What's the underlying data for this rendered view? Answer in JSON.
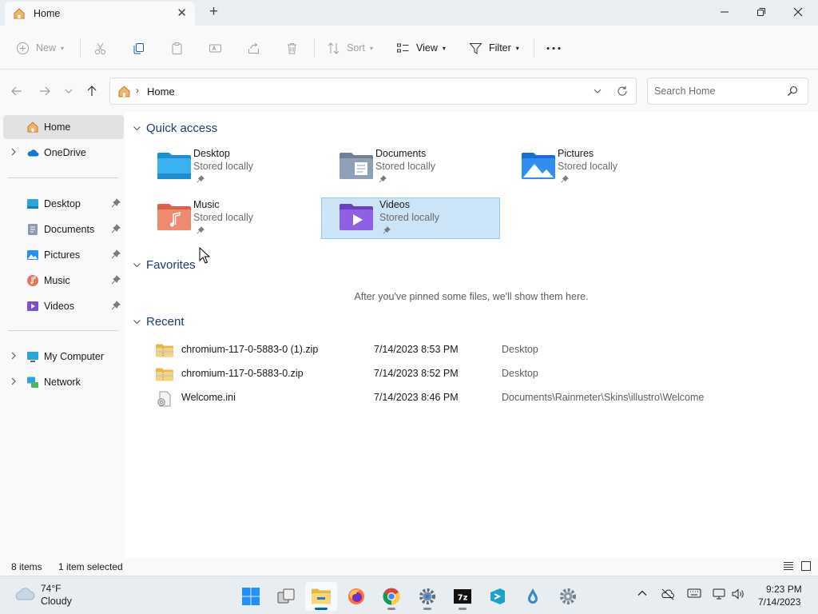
{
  "window": {
    "tab_title": "Home",
    "minimize_icon": "minimize-icon",
    "maximize_icon": "restore-icon",
    "close_icon": "close-icon"
  },
  "toolbar": {
    "new_label": "New",
    "sort_label": "Sort",
    "view_label": "View",
    "filter_label": "Filter",
    "more_icon": "ellipsis-icon"
  },
  "address": {
    "path": "Home",
    "search_placeholder": "Search Home"
  },
  "sidebar": {
    "items": [
      {
        "label": "Home",
        "icon": "home-icon",
        "selected": true
      },
      {
        "label": "OneDrive",
        "icon": "onedrive-icon",
        "expandable": true
      },
      {
        "label": "Desktop",
        "icon": "desktop-folder-icon",
        "pinned": true
      },
      {
        "label": "Documents",
        "icon": "documents-folder-icon",
        "pinned": true
      },
      {
        "label": "Pictures",
        "icon": "pictures-folder-icon",
        "pinned": true
      },
      {
        "label": "Music",
        "icon": "music-folder-icon",
        "pinned": true
      },
      {
        "label": "Videos",
        "icon": "videos-folder-icon",
        "pinned": true
      },
      {
        "label": "My Computer",
        "icon": "computer-icon",
        "expandable": true
      },
      {
        "label": "Network",
        "icon": "network-icon",
        "expandable": true
      }
    ]
  },
  "main": {
    "quick_access_title": "Quick access",
    "favorites_title": "Favorites",
    "recent_title": "Recent",
    "favorites_empty": "After you've pinned some files, we'll show them here.",
    "quick_access": [
      {
        "name": "Desktop",
        "sub": "Stored locally"
      },
      {
        "name": "Documents",
        "sub": "Stored locally"
      },
      {
        "name": "Pictures",
        "sub": "Stored locally"
      },
      {
        "name": "Music",
        "sub": "Stored locally"
      },
      {
        "name": "Videos",
        "sub": "Stored locally",
        "selected": true
      }
    ],
    "recent": [
      {
        "name": "chromium-117-0-5883-0 (1).zip",
        "date": "7/14/2023 8:53 PM",
        "location": "Desktop",
        "icon": "zip-folder-icon"
      },
      {
        "name": "chromium-117-0-5883-0.zip",
        "date": "7/14/2023 8:52 PM",
        "location": "Desktop",
        "icon": "zip-folder-icon"
      },
      {
        "name": "Welcome.ini",
        "date": "7/14/2023 8:46 PM",
        "location": "Documents\\Rainmeter\\Skins\\illustro\\Welcome",
        "icon": "settings-file-icon"
      }
    ]
  },
  "status": {
    "items_count": "8 items",
    "selection": "1 item selected"
  },
  "taskbar": {
    "weather_temp": "74°F",
    "weather_cond": "Cloudy",
    "time": "9:23 PM",
    "date": "7/14/2023"
  },
  "colors": {
    "accent": "#0067c0",
    "selection": "#cce4f7",
    "section_header": "#1e3b6e"
  }
}
